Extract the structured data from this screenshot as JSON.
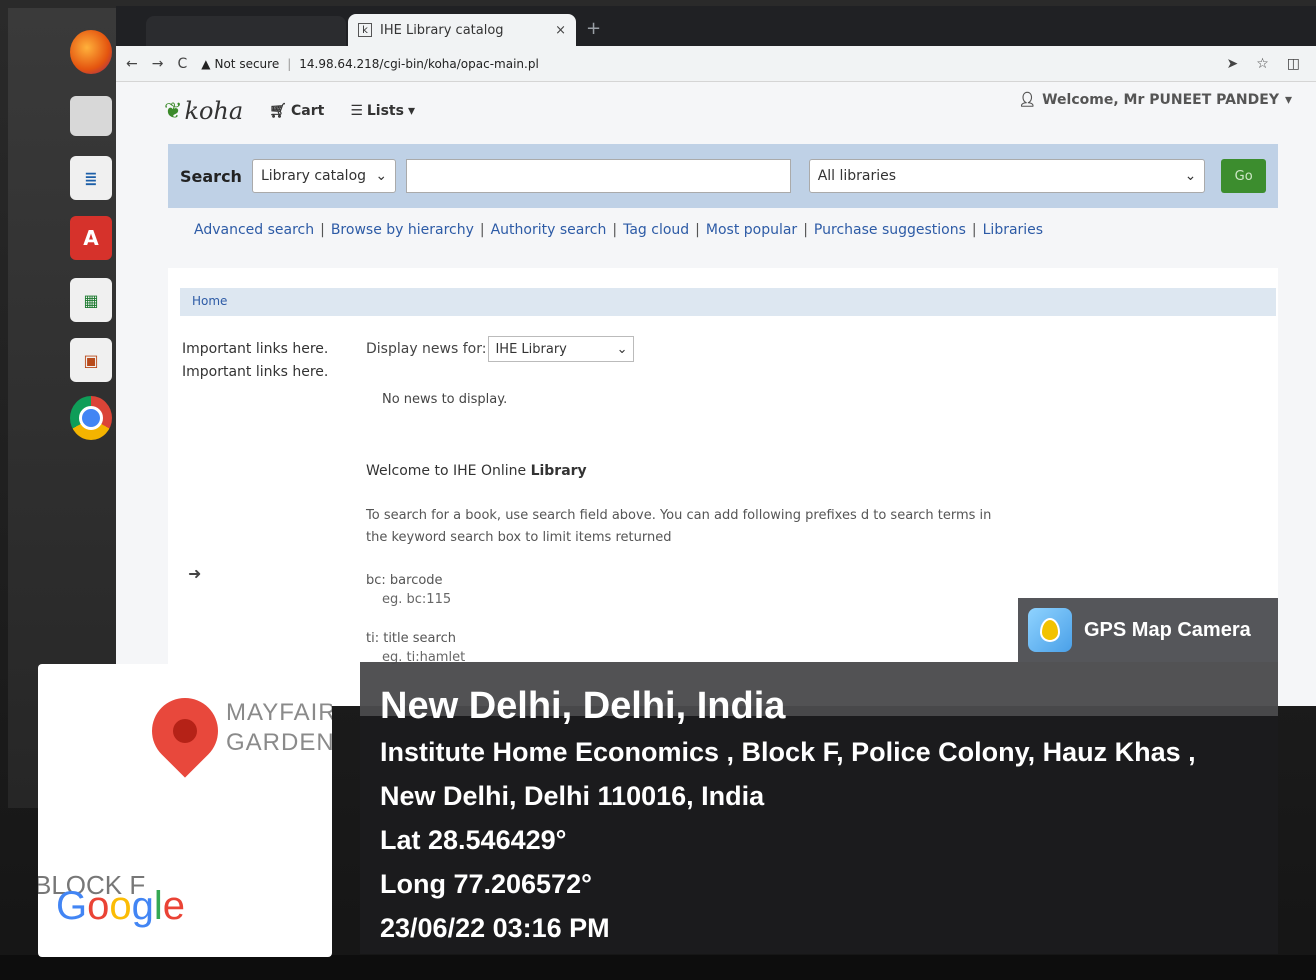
{
  "browser": {
    "tab_title": "IHE Library catalog",
    "tab_favicon": "k",
    "tab_close": "×",
    "new_tab": "+",
    "security_label": "Not secure",
    "url": "14.98.64.218/cgi-bin/koha/opac-main.pl"
  },
  "koha": {
    "logo_text": "koha",
    "nav": {
      "cart": "Cart",
      "lists": "Lists"
    },
    "welcome": "Welcome, Mr PUNEET PANDEY",
    "search": {
      "label": "Search",
      "scope_selected": "Library catalog",
      "query_value": "",
      "library_selected": "All libraries",
      "go_label": "Go"
    },
    "more_searches": [
      "Advanced search",
      "Browse by hierarchy",
      "Authority search",
      "Tag cloud",
      "Most popular",
      "Purchase suggestions",
      "Libraries"
    ],
    "breadcrumb": "Home",
    "side_links": [
      "Important links here.",
      "Important links here."
    ],
    "news": {
      "label": "Display news for:",
      "selected": "IHE Library",
      "empty": "No news to display."
    },
    "welcome_heading_prefix": "Welcome to IHE ",
    "welcome_heading_online": "Online ",
    "welcome_heading_suffix": "Library",
    "instructions": "To search for a book, use search field above. You can add following prefixes d to search terms in the keyword search box to limit items returned",
    "prefixes": [
      {
        "label": "bc: barcode",
        "example": "eg. bc:115"
      },
      {
        "label": "ti: title search",
        "example": "eg. ti:hamlet"
      }
    ]
  },
  "gps": {
    "brand": "GPS Map Camera",
    "city": "New Delhi, Delhi, India",
    "address_line1": "Institute Home Economics , Block F, Police Colony, Hauz Khas ,",
    "address_line2": "New Delhi, Delhi 110016, India",
    "lat": "Lat 28.546429°",
    "long": "Long 77.206572°",
    "datetime": "23/06/22 03:16 PM",
    "map_label_line1": "MAYFAIR",
    "map_label_line2": "GARDENS",
    "map_block": "BLOCK F"
  },
  "colors": {
    "masthead": "#bfd1e6",
    "link": "#2d5ba6",
    "go_button": "#3c8d2e",
    "map_pin": "#e8483c"
  }
}
